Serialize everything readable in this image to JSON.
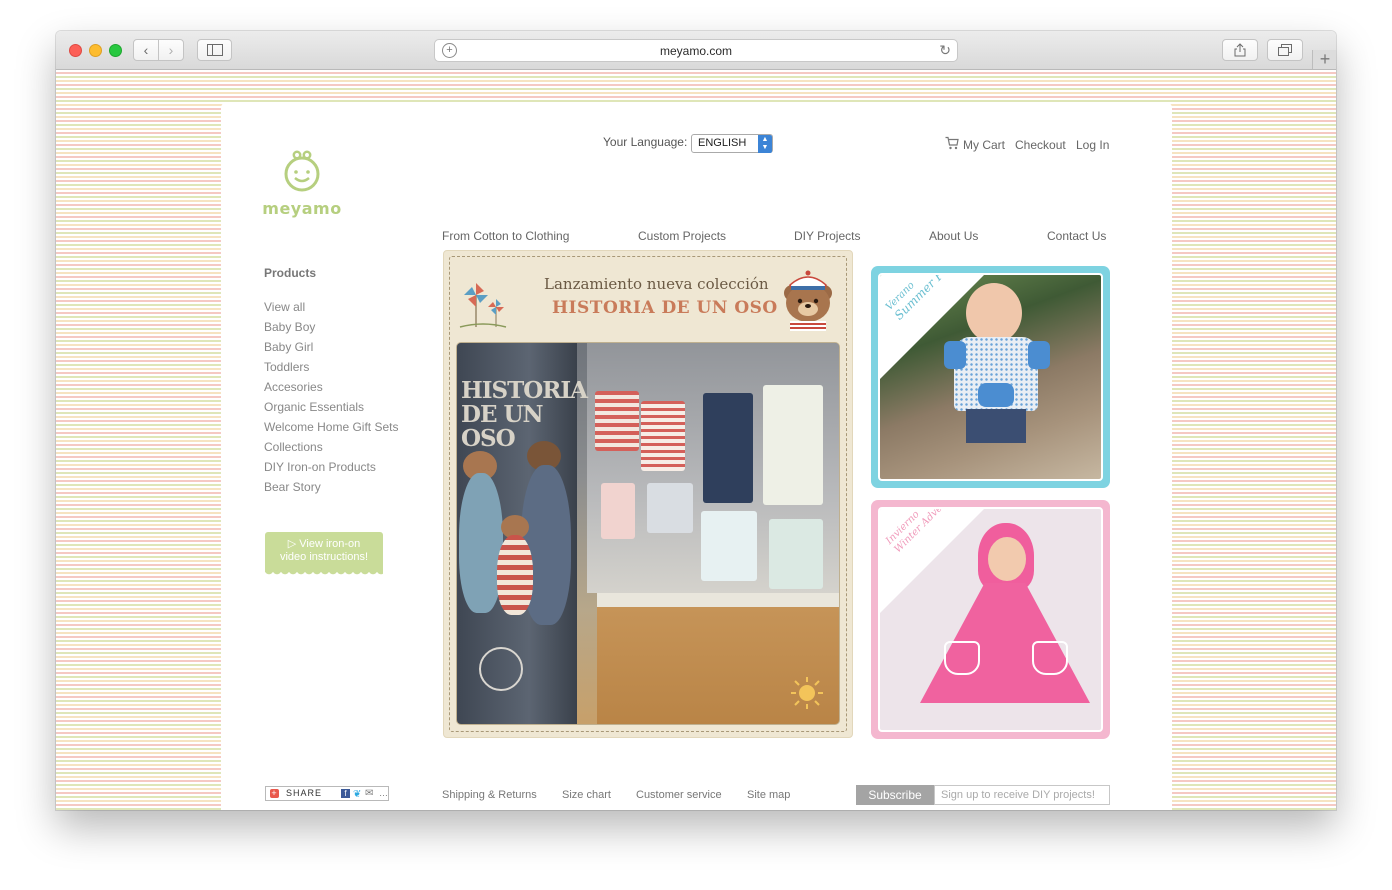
{
  "browser": {
    "url": "meyamo.com"
  },
  "site": {
    "logo_text": "meyamo",
    "language_label": "Your Language:",
    "language_value": "ENGLISH",
    "top_links": [
      "My Cart",
      "Checkout",
      "Log In"
    ],
    "main_nav": [
      "From Cotton to Clothing",
      "Custom Projects",
      "DIY Projects",
      "About Us",
      "Contact Us"
    ]
  },
  "sidebar": {
    "title": "Products",
    "items": [
      "View all",
      "Baby Boy",
      "Baby Girl",
      "Toddlers",
      "Accesories",
      "Organic Essentials",
      "Welcome Home Gift Sets",
      "Collections",
      "DIY Iron-on Products",
      "Bear Story"
    ],
    "video_button_line1": "▷ View iron-on",
    "video_button_line2": "video instructions!"
  },
  "feature": {
    "title_line1": "Lanzamiento nueva colección",
    "title_line2": "HISTORIA DE UN OSO",
    "pillar_text_line1": "HISTORIA",
    "pillar_text_line2": "DE UN OSO"
  },
  "promos": [
    {
      "season": "Verano",
      "caption": "Summer Fun",
      "color": "#7ed3e1"
    },
    {
      "season": "Invierno",
      "caption": "Winter Adventures",
      "color": "#f4b7cf"
    }
  ],
  "footer": {
    "share_label": "SHARE",
    "links": [
      "Shipping & Returns",
      "Size chart",
      "Customer service",
      "Site map"
    ],
    "subscribe_label": "Subscribe",
    "subscribe_placeholder": "Sign up to receive DIY projects!"
  }
}
